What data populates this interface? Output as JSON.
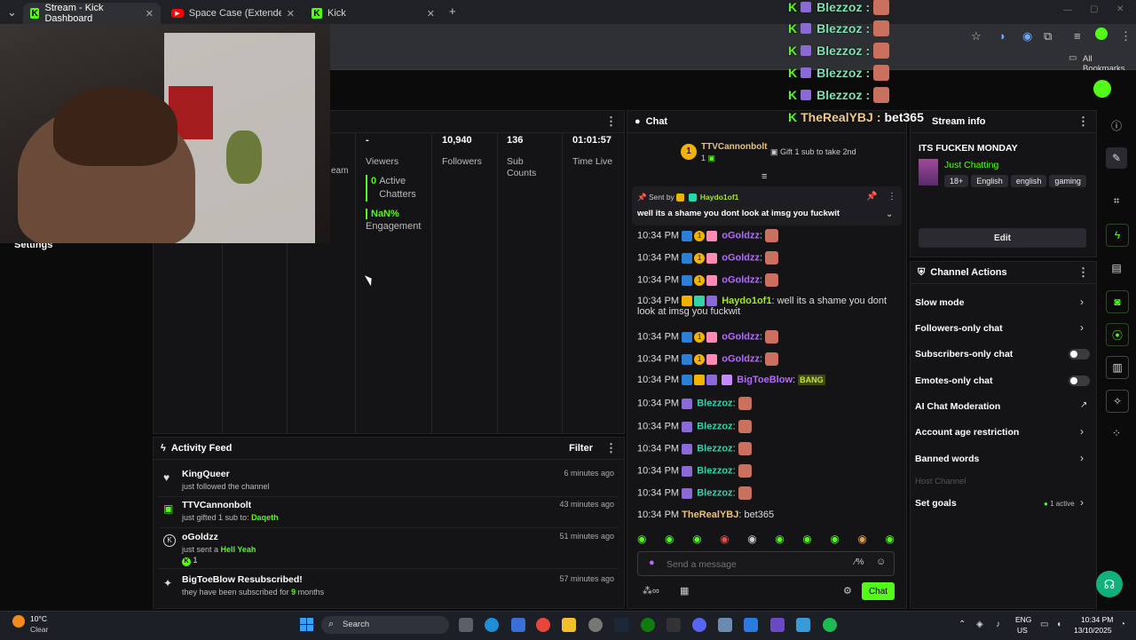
{
  "browser": {
    "tabs": [
      {
        "label": "Stream - Kick Dashboard",
        "icon": "kick-icon"
      },
      {
        "label": "Space Case (Extended Mix) - Yo",
        "icon": "youtube-icon"
      },
      {
        "label": "Kick",
        "icon": "kick-icon"
      }
    ],
    "bookmarks_label": "All Bookmarks"
  },
  "stream_panel": {
    "stats": [
      {
        "value": "-",
        "label_a": "Viewers",
        "label_b": ""
      },
      {
        "value": "10,940",
        "label_a": "Followers",
        "label_b": ""
      },
      {
        "value": "136",
        "label_a": "Sub",
        "label_b": "Counts"
      },
      {
        "value": "01:01:57",
        "label_a": "Time Live",
        "label_b": ""
      }
    ],
    "active_chatters_value": "0",
    "active_chatters_label": "Active Chatters",
    "engagement_value": "NaN%",
    "engagement_label": "Engagement",
    "partial_label": "eam",
    "settings_label": "Settings"
  },
  "activity": {
    "title": "Activity Feed",
    "filter_label": "Filter",
    "items": [
      {
        "name": "KingQueer",
        "desc": "just followed the channel",
        "highlight": "",
        "time": "6 minutes ago",
        "icon": "heart-icon"
      },
      {
        "name": "TTVCannonbolt",
        "desc": "just gifted 1 sub to:",
        "highlight": "Daqeth",
        "time": "43 minutes ago",
        "icon": "gift-icon"
      },
      {
        "name": "oGoldzz",
        "desc": "just sent a",
        "highlight": "Hell Yeah",
        "time": "51 minutes ago",
        "icon": "kick-coin-icon",
        "extra": "1"
      },
      {
        "name": "BigToeBlow Resubscribed!",
        "desc": "they have been subscribed for",
        "highlight": "9",
        "desc_suffix": "months",
        "time": "57 minutes ago",
        "icon": "sparkle-icon"
      }
    ]
  },
  "chat": {
    "title": "Chat",
    "top_gifter": {
      "rank": "1",
      "name": "TTVCannonbolt",
      "count": "1",
      "cta": "Gift 1 sub to take 2nd"
    },
    "pinned": {
      "sent_by_label": "Sent by",
      "author": "Haydo1of1",
      "text": "well its a shame you dont look at imsg you fuckwit"
    },
    "messages": [
      {
        "time": "10:34 PM",
        "user": "oGoldzz",
        "text": "",
        "color": "purple"
      },
      {
        "time": "10:34 PM",
        "user": "oGoldzz",
        "text": "",
        "color": "purple"
      },
      {
        "time": "10:34 PM",
        "user": "oGoldzz",
        "text": "",
        "color": "purple"
      },
      {
        "time": "10:34 PM",
        "user": "Haydo1of1",
        "text": "well its a shame you dont",
        "text2": "look at imsg you fuckwit",
        "color": "lime"
      },
      {
        "time": "10:34 PM",
        "user": "oGoldzz",
        "text": "",
        "color": "purple"
      },
      {
        "time": "10:34 PM",
        "user": "oGoldzz",
        "text": "",
        "color": "purple"
      },
      {
        "time": "10:34 PM",
        "user": "BigToeBlow",
        "text": "BANG",
        "color": "purple"
      },
      {
        "time": "10:34 PM",
        "user": "Blezzoz",
        "text": "",
        "color": "teal"
      },
      {
        "time": "10:34 PM",
        "user": "Blezzoz",
        "text": "",
        "color": "teal"
      },
      {
        "time": "10:34 PM",
        "user": "Blezzoz",
        "text": "",
        "color": "teal"
      },
      {
        "time": "10:34 PM",
        "user": "Blezzoz",
        "text": "",
        "color": "teal"
      },
      {
        "time": "10:34 PM",
        "user": "Blezzoz",
        "text": "",
        "color": "teal"
      },
      {
        "time": "10:34 PM",
        "user": "TheRealYBJ",
        "text": "bet365",
        "color": "gold"
      }
    ],
    "input_placeholder": "Send a message",
    "send_label": "Chat"
  },
  "stream_info": {
    "title": "Stream info",
    "stream_title": "ITS FUCKEN MONDAY",
    "category": "Just Chatting",
    "tags": [
      "18+",
      "English",
      "english",
      "gaming"
    ],
    "edit_label": "Edit"
  },
  "channel_actions": {
    "title": "Channel Actions",
    "items": [
      {
        "label": "Slow mode",
        "control": "chevron"
      },
      {
        "label": "Followers-only chat",
        "control": "chevron"
      },
      {
        "label": "Subscribers-only chat",
        "control": "toggle",
        "state": "off"
      },
      {
        "label": "Emotes-only chat",
        "control": "toggle",
        "state": "off"
      },
      {
        "label": "AI Chat Moderation",
        "control": "external"
      },
      {
        "label": "Account age restriction",
        "control": "chevron"
      },
      {
        "label": "Banned words",
        "control": "chevron"
      },
      {
        "label": "Host Channel",
        "control": "none",
        "disabled": true
      },
      {
        "label": "Set goals",
        "control": "chevron",
        "status": "1 active"
      }
    ]
  },
  "overlay": {
    "rows": [
      {
        "user": "Blezzoz",
        "text": ""
      },
      {
        "user": "Blezzoz",
        "text": ""
      },
      {
        "user": "Blezzoz",
        "text": ""
      },
      {
        "user": "Blezzoz",
        "text": ""
      },
      {
        "user": "Blezzoz",
        "text": ""
      },
      {
        "user": "TheRealYBJ",
        "text": "bet365"
      }
    ]
  },
  "taskbar": {
    "weather_temp": "10°C",
    "weather_desc": "Clear",
    "search_label": "Search",
    "lang_a": "ENG",
    "lang_b": "US",
    "time": "10:34 PM",
    "date": "13/10/2025"
  },
  "colors": {
    "kick_green": "#53fc18",
    "bg": "#0d0d0f",
    "panel": "#141417"
  }
}
